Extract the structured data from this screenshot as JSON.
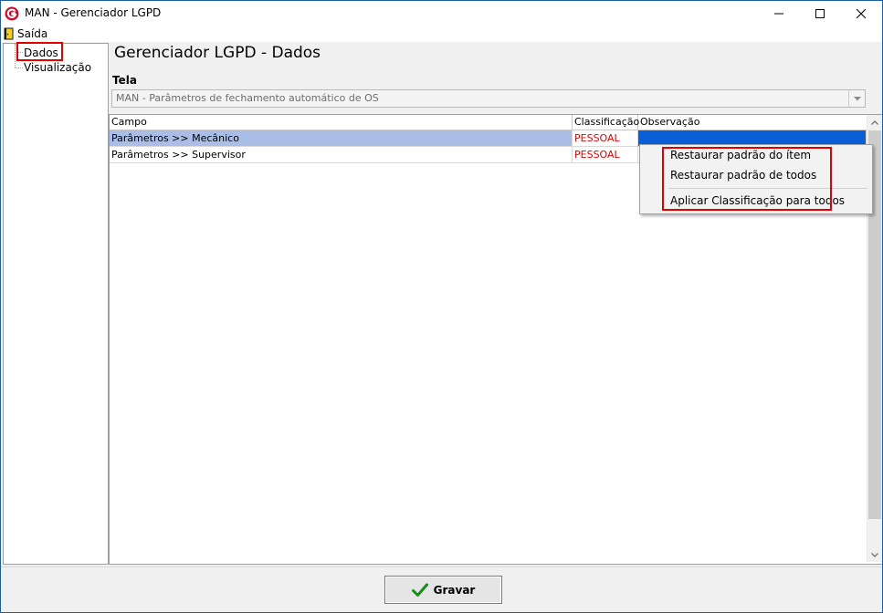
{
  "window": {
    "title": "MAN - Gerenciador LGPD",
    "accent": "#c8102e"
  },
  "menu": {
    "exit_label": "Saída",
    "exit_icon": "door-exit-icon"
  },
  "tree": {
    "items": [
      {
        "label": "Dados"
      },
      {
        "label": "Visualização"
      }
    ]
  },
  "main": {
    "title": "Gerenciador LGPD - Dados",
    "tela_label": "Tela",
    "tela_value": "MAN - Parâmetros de fechamento automático de OS"
  },
  "grid": {
    "columns": [
      "Campo",
      "Classificação",
      "Observação"
    ],
    "rows": [
      {
        "campo": "Parâmetros >> Mecânico",
        "classificacao": "PESSOAL",
        "observacao": ""
      },
      {
        "campo": "Parâmetros >> Supervisor",
        "classificacao": "PESSOAL",
        "observacao": ""
      }
    ]
  },
  "context_menu": {
    "items": [
      {
        "label": "Restaurar padrão do ítem"
      },
      {
        "label": "Restaurar padrão de todos"
      },
      {
        "label": "Aplicar Classificação para todos"
      }
    ]
  },
  "footer": {
    "save_label": "Gravar",
    "save_icon": "check-icon"
  },
  "colors": {
    "selection": "#0a5fd6",
    "selection_light": "#a9bde6",
    "highlight_box": "#e00000",
    "classification_text": "#e00000"
  }
}
